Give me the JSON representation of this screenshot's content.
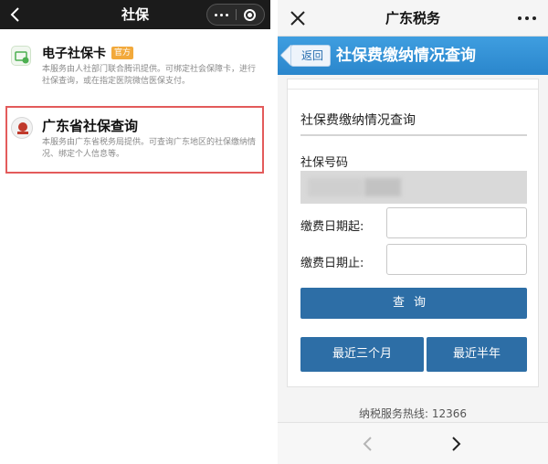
{
  "left_panel": {
    "title": "社保",
    "services": [
      {
        "name": "电子社保卡",
        "badge": "官方",
        "description": "本服务由人社部门联合腾讯提供。可绑定社会保障卡，进行社保查询，或在指定医院微信医保支付。"
      },
      {
        "name": "广东省社保查询",
        "description": "本服务由广东省税务局提供。可查询广东地区的社保缴纳情况、绑定个人信息等。"
      }
    ]
  },
  "right_panel": {
    "title": "广东税务",
    "back_label": "返回",
    "page_title": "社保费缴纳情况查询",
    "section_title": "社保费缴纳情况查询",
    "ss_number_label": "社保号码",
    "start_date_label": "缴费日期起:",
    "end_date_label": "缴费日期止:",
    "query_button": "查询",
    "last_three_months_button": "最近三个月",
    "last_half_year_button": "最近半年",
    "hotline": "纳税服务热线: 12366"
  },
  "colors": {
    "accent_blue": "#2d6ea6",
    "header_blue": "#3f9ee0",
    "highlight_red": "#e35b5b",
    "badge_orange": "#f2a93b"
  },
  "icons": [
    "chevron-left-icon",
    "more-icon",
    "close-circle-icon",
    "close-icon",
    "social-card-icon",
    "tax-logo-icon",
    "chevron-right-icon"
  ]
}
